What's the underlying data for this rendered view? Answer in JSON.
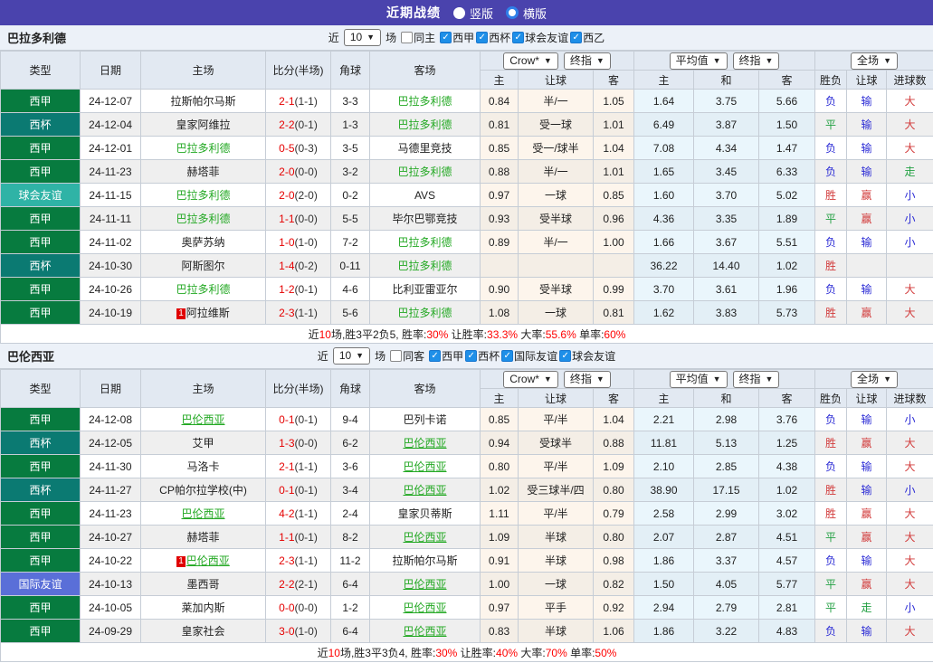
{
  "banner": {
    "title": "近期战绩",
    "options": [
      {
        "label": "竖版",
        "selected": false
      },
      {
        "label": "横版",
        "selected": true
      }
    ]
  },
  "colors": {
    "banner_bg": "#4A43AD",
    "laliga_green": "#077B3F",
    "cup_teal": "#0B7A72",
    "club_friendly_teal": "#2FB3A6",
    "intl_friendly_blue": "#5A6FD8",
    "subject_team_green": "#22A822",
    "score_red": "#E50000",
    "win_red": "#D23B3B",
    "lose_blue": "#2B2BD5",
    "draw_green": "#22A042",
    "checkbox_blue": "#1E8FE8"
  },
  "columns": {
    "type": "类型",
    "date": "日期",
    "home": "主场",
    "score": "比分(半场)",
    "corners": "角球",
    "away": "客场",
    "h": "主",
    "handicap": "让球",
    "a": "客",
    "avg_h": "主",
    "avg_d": "和",
    "avg_a": "客",
    "result": "胜负",
    "h_result": "让球",
    "goals": "进球数"
  },
  "dropdowns": {
    "crow": "Crow*",
    "final1": "终指",
    "avg": "平均值",
    "final2": "终指",
    "full": "全场"
  },
  "tables": [
    {
      "team": "巴拉多利德",
      "subject_is_link": false,
      "filter": {
        "near": "近",
        "count": "10",
        "games": "场",
        "same": "同主",
        "same_checked": false,
        "leagues": [
          "西甲",
          "西杯",
          "球会友谊",
          "西乙"
        ]
      },
      "rows": [
        {
          "type": "西甲",
          "date": "24-12-07",
          "home": "拉斯帕尔马斯",
          "score": "2-1",
          "half": "1-1",
          "corners": "3-3",
          "away": "巴拉多利德",
          "o1": "0.84",
          "hd": "半/一",
          "o2": "1.05",
          "a1": "1.64",
          "a2": "3.75",
          "a3": "5.66",
          "res": "负",
          "hres": "输",
          "goal": "大"
        },
        {
          "type": "西杯",
          "date": "24-12-04",
          "home": "皇家阿维拉",
          "score": "2-2",
          "half": "0-1",
          "corners": "1-3",
          "away": "巴拉多利德",
          "o1": "0.81",
          "hd": "受一球",
          "o2": "1.01",
          "a1": "6.49",
          "a2": "3.87",
          "a3": "1.50",
          "res": "平",
          "hres": "输",
          "goal": "大"
        },
        {
          "type": "西甲",
          "date": "24-12-01",
          "home": "巴拉多利德",
          "score": "0-5",
          "half": "0-3",
          "corners": "3-5",
          "away": "马德里竞技",
          "o1": "0.85",
          "hd": "受一/球半",
          "o2": "1.04",
          "a1": "7.08",
          "a2": "4.34",
          "a3": "1.47",
          "res": "负",
          "hres": "输",
          "goal": "大"
        },
        {
          "type": "西甲",
          "date": "24-11-23",
          "home": "赫塔菲",
          "score": "2-0",
          "half": "0-0",
          "corners": "3-2",
          "away": "巴拉多利德",
          "o1": "0.88",
          "hd": "半/一",
          "o2": "1.01",
          "a1": "1.65",
          "a2": "3.45",
          "a3": "6.33",
          "res": "负",
          "hres": "输",
          "goal": "走"
        },
        {
          "type": "球会友谊",
          "date": "24-11-15",
          "home": "巴拉多利德",
          "score": "2-0",
          "half": "2-0",
          "corners": "0-2",
          "away": "AVS",
          "o1": "0.97",
          "hd": "一球",
          "o2": "0.85",
          "a1": "1.60",
          "a2": "3.70",
          "a3": "5.02",
          "res": "胜",
          "hres": "赢",
          "goal": "小"
        },
        {
          "type": "西甲",
          "date": "24-11-11",
          "home": "巴拉多利德",
          "score": "1-1",
          "half": "0-0",
          "corners": "5-5",
          "away": "毕尔巴鄂竞技",
          "o1": "0.93",
          "hd": "受半球",
          "o2": "0.96",
          "a1": "4.36",
          "a2": "3.35",
          "a3": "1.89",
          "res": "平",
          "hres": "赢",
          "goal": "小"
        },
        {
          "type": "西甲",
          "date": "24-11-02",
          "home": "奥萨苏纳",
          "score": "1-0",
          "half": "1-0",
          "corners": "7-2",
          "away": "巴拉多利德",
          "o1": "0.89",
          "hd": "半/一",
          "o2": "1.00",
          "a1": "1.66",
          "a2": "3.67",
          "a3": "5.51",
          "res": "负",
          "hres": "输",
          "goal": "小"
        },
        {
          "type": "西杯",
          "date": "24-10-30",
          "home": "阿斯图尔",
          "score": "1-4",
          "half": "0-2",
          "corners": "0-11",
          "away": "巴拉多利德",
          "o1": "",
          "hd": "",
          "o2": "",
          "a1": "36.22",
          "a2": "14.40",
          "a3": "1.02",
          "res": "胜",
          "hres": "",
          "goal": ""
        },
        {
          "type": "西甲",
          "date": "24-10-26",
          "home": "巴拉多利德",
          "score": "1-2",
          "half": "0-1",
          "corners": "4-6",
          "away": "比利亚雷亚尔",
          "o1": "0.90",
          "hd": "受半球",
          "o2": "0.99",
          "a1": "3.70",
          "a2": "3.61",
          "a3": "1.96",
          "res": "负",
          "hres": "输",
          "goal": "大"
        },
        {
          "type": "西甲",
          "date": "24-10-19",
          "home": "阿拉维斯",
          "home_badge": "1",
          "score": "2-3",
          "half": "1-1",
          "corners": "5-6",
          "away": "巴拉多利德",
          "o1": "1.08",
          "hd": "一球",
          "o2": "0.81",
          "a1": "1.62",
          "a2": "3.83",
          "a3": "5.73",
          "res": "胜",
          "hres": "赢",
          "goal": "大"
        }
      ],
      "summary": [
        [
          "近",
          "k"
        ],
        [
          "10",
          "r"
        ],
        [
          "场,胜3平2负5, 胜率:",
          "k"
        ],
        [
          "30%",
          "r"
        ],
        [
          " 让胜率:",
          "k"
        ],
        [
          "33.3%",
          "r"
        ],
        [
          " 大率:",
          "k"
        ],
        [
          "55.6%",
          "r"
        ],
        [
          " 单率:",
          "k"
        ],
        [
          "60%",
          "r"
        ]
      ]
    },
    {
      "team": "巴伦西亚",
      "subject_is_link": true,
      "filter": {
        "near": "近",
        "count": "10",
        "games": "场",
        "same": "同客",
        "same_checked": false,
        "leagues": [
          "西甲",
          "西杯",
          "国际友谊",
          "球会友谊"
        ]
      },
      "rows": [
        {
          "type": "西甲",
          "date": "24-12-08",
          "home": "巴伦西亚",
          "score": "0-1",
          "half": "0-1",
          "corners": "9-4",
          "away": "巴列卡诺",
          "o1": "0.85",
          "hd": "平/半",
          "o2": "1.04",
          "a1": "2.21",
          "a2": "2.98",
          "a3": "3.76",
          "res": "负",
          "hres": "输",
          "goal": "小"
        },
        {
          "type": "西杯",
          "date": "24-12-05",
          "home": "艾甲",
          "score": "1-3",
          "half": "0-0",
          "corners": "6-2",
          "away": "巴伦西亚",
          "o1": "0.94",
          "hd": "受球半",
          "o2": "0.88",
          "a1": "11.81",
          "a2": "5.13",
          "a3": "1.25",
          "res": "胜",
          "hres": "赢",
          "goal": "大"
        },
        {
          "type": "西甲",
          "date": "24-11-30",
          "home": "马洛卡",
          "score": "2-1",
          "half": "1-1",
          "corners": "3-6",
          "away": "巴伦西亚",
          "o1": "0.80",
          "hd": "平/半",
          "o2": "1.09",
          "a1": "2.10",
          "a2": "2.85",
          "a3": "4.38",
          "res": "负",
          "hres": "输",
          "goal": "大"
        },
        {
          "type": "西杯",
          "date": "24-11-27",
          "home": "CP帕尔拉学校(中)",
          "score": "0-1",
          "half": "0-1",
          "corners": "3-4",
          "away": "巴伦西亚",
          "o1": "1.02",
          "hd": "受三球半/四",
          "o2": "0.80",
          "a1": "38.90",
          "a2": "17.15",
          "a3": "1.02",
          "res": "胜",
          "hres": "输",
          "goal": "小"
        },
        {
          "type": "西甲",
          "date": "24-11-23",
          "home": "巴伦西亚",
          "score": "4-2",
          "half": "1-1",
          "corners": "2-4",
          "away": "皇家贝蒂斯",
          "o1": "1.11",
          "hd": "平/半",
          "o2": "0.79",
          "a1": "2.58",
          "a2": "2.99",
          "a3": "3.02",
          "res": "胜",
          "hres": "赢",
          "goal": "大"
        },
        {
          "type": "西甲",
          "date": "24-10-27",
          "home": "赫塔菲",
          "score": "1-1",
          "half": "0-1",
          "corners": "8-2",
          "away": "巴伦西亚",
          "o1": "1.09",
          "hd": "半球",
          "o2": "0.80",
          "a1": "2.07",
          "a2": "2.87",
          "a3": "4.51",
          "res": "平",
          "hres": "赢",
          "goal": "大"
        },
        {
          "type": "西甲",
          "date": "24-10-22",
          "home": "巴伦西亚",
          "home_badge": "1",
          "score": "2-3",
          "half": "1-1",
          "corners": "11-2",
          "away": "拉斯帕尔马斯",
          "o1": "0.91",
          "hd": "半球",
          "o2": "0.98",
          "a1": "1.86",
          "a2": "3.37",
          "a3": "4.57",
          "res": "负",
          "hres": "输",
          "goal": "大"
        },
        {
          "type": "国际友谊",
          "date": "24-10-13",
          "home": "墨西哥",
          "score": "2-2",
          "half": "2-1",
          "corners": "6-4",
          "away": "巴伦西亚",
          "o1": "1.00",
          "hd": "一球",
          "o2": "0.82",
          "a1": "1.50",
          "a2": "4.05",
          "a3": "5.77",
          "res": "平",
          "hres": "赢",
          "goal": "大"
        },
        {
          "type": "西甲",
          "date": "24-10-05",
          "home": "莱加内斯",
          "score": "0-0",
          "half": "0-0",
          "corners": "1-2",
          "away": "巴伦西亚",
          "o1": "0.97",
          "hd": "平手",
          "o2": "0.92",
          "a1": "2.94",
          "a2": "2.79",
          "a3": "2.81",
          "res": "平",
          "hres": "走",
          "goal": "小"
        },
        {
          "type": "西甲",
          "date": "24-09-29",
          "home": "皇家社会",
          "score": "3-0",
          "half": "1-0",
          "corners": "6-4",
          "away": "巴伦西亚",
          "o1": "0.83",
          "hd": "半球",
          "o2": "1.06",
          "a1": "1.86",
          "a2": "3.22",
          "a3": "4.83",
          "res": "负",
          "hres": "输",
          "goal": "大"
        }
      ],
      "summary": [
        [
          "近",
          "k"
        ],
        [
          "10",
          "r"
        ],
        [
          "场,胜3平3负4, 胜率:",
          "k"
        ],
        [
          "30%",
          "r"
        ],
        [
          " 让胜率:",
          "k"
        ],
        [
          "40%",
          "r"
        ],
        [
          " 大率:",
          "k"
        ],
        [
          "70%",
          "r"
        ],
        [
          " 单率:",
          "k"
        ],
        [
          "50%",
          "r"
        ]
      ]
    }
  ]
}
